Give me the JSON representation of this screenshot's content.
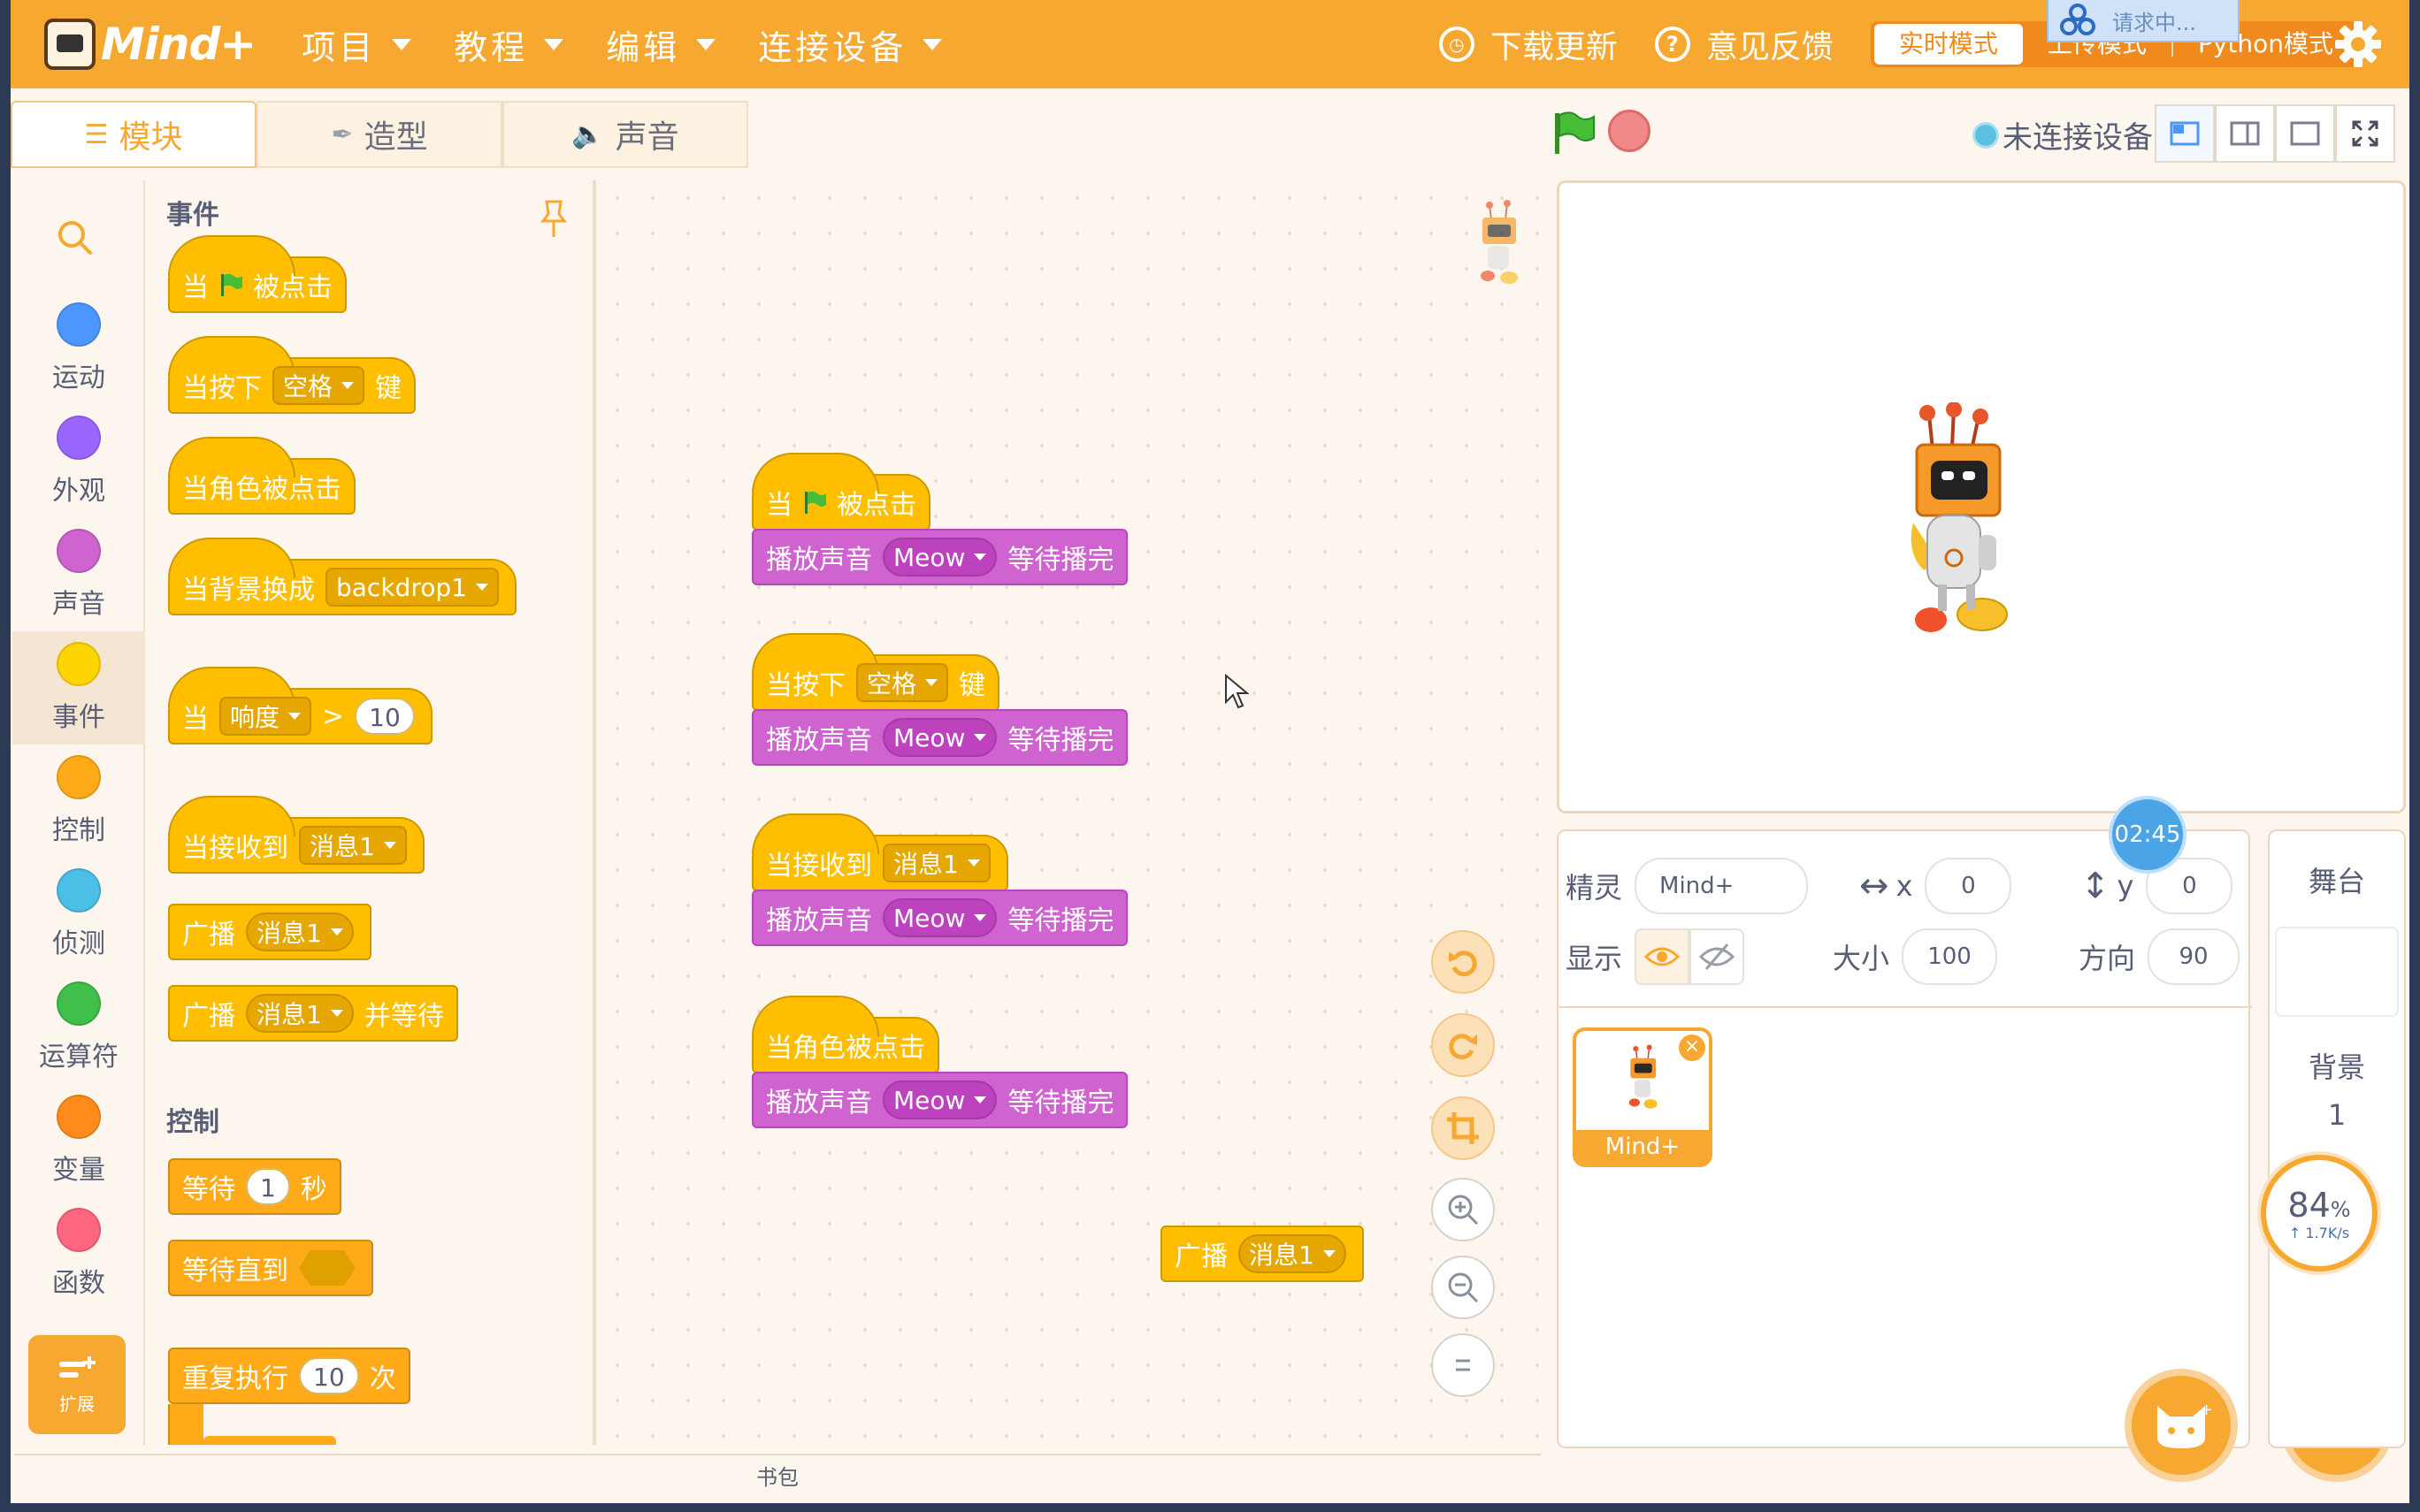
{
  "app": {
    "logo_text": "Mind+",
    "menus": [
      "项目",
      "教程",
      "编辑",
      "连接设备"
    ],
    "download_update": "下载更新",
    "feedback": "意见反馈",
    "modes": [
      "实时模式",
      "上传模式",
      "Python模式"
    ],
    "active_mode": "实时模式",
    "request_toast": "请求中..."
  },
  "tabs": [
    {
      "label": "模块",
      "icon": "blocks-icon",
      "active": true
    },
    {
      "label": "造型",
      "icon": "brush-icon",
      "active": false
    },
    {
      "label": "声音",
      "icon": "speaker-icon",
      "active": false
    }
  ],
  "connection_status": "未连接设备",
  "categories": [
    {
      "label": "运动",
      "color": "#4c97ff"
    },
    {
      "label": "外观",
      "color": "#9966ff"
    },
    {
      "label": "声音",
      "color": "#cf63cf"
    },
    {
      "label": "事件",
      "color": "#ffd500",
      "active": true
    },
    {
      "label": "控制",
      "color": "#ffab19"
    },
    {
      "label": "侦测",
      "color": "#4cbfe6"
    },
    {
      "label": "运算符",
      "color": "#40bf4a"
    },
    {
      "label": "变量",
      "color": "#ff8c1a"
    },
    {
      "label": "函数",
      "color": "#ff6680"
    }
  ],
  "extensions_label": "扩展",
  "palette": {
    "events_heading": "事件",
    "control_heading": "控制",
    "blocks": {
      "when_flag_a": "当",
      "when_flag_b": "被点击",
      "when_key_a": "当按下",
      "when_key_dropdown": "空格",
      "when_key_b": "键",
      "when_sprite_clicked": "当角色被点击",
      "when_backdrop_a": "当背景换成",
      "when_backdrop_dropdown": "backdrop1",
      "when_sensor_a": "当",
      "when_sensor_dropdown": "响度",
      "when_sensor_op": ">",
      "when_sensor_value": "10",
      "when_receive_a": "当接收到",
      "when_receive_dropdown": "消息1",
      "broadcast_a": "广播",
      "broadcast_dropdown": "消息1",
      "broadcast_wait_a": "广播",
      "broadcast_wait_dropdown": "消息1",
      "broadcast_wait_b": "并等待",
      "wait_a": "等待",
      "wait_value": "1",
      "wait_b": "秒",
      "wait_until": "等待直到",
      "repeat_a": "重复执行",
      "repeat_value": "10",
      "repeat_b": "次"
    }
  },
  "scripts": {
    "play_a": "播放声音",
    "sound": "Meow",
    "play_b": "等待播完",
    "s1_a": "当",
    "s1_b": "被点击",
    "s2_a": "当按下",
    "s2_dropdown": "空格",
    "s2_b": "键",
    "s3_a": "当接收到",
    "s3_dropdown": "消息1",
    "s4": "当角色被点击",
    "loose_a": "广播",
    "loose_dropdown": "消息1"
  },
  "backpack_label": "书包",
  "sprite_info": {
    "sprite_label": "精灵",
    "sprite_name": "Mind+",
    "x_label": "x",
    "x_value": "0",
    "y_label": "y",
    "y_value": "0",
    "show_label": "显示",
    "size_label": "大小",
    "size_value": "100",
    "direction_label": "方向",
    "direction_value": "90"
  },
  "sprite_card_name": "Mind+",
  "timer": "02:45",
  "stage_panel": {
    "stage_label": "舞台",
    "backdrop_label": "背景",
    "backdrop_count": "1"
  },
  "gauge": {
    "value": "84",
    "unit": "%",
    "speed": "1.7K/s"
  },
  "colors": {
    "accent": "#f7a830",
    "events": "#ffbf00",
    "sound": "#cf63cf"
  }
}
